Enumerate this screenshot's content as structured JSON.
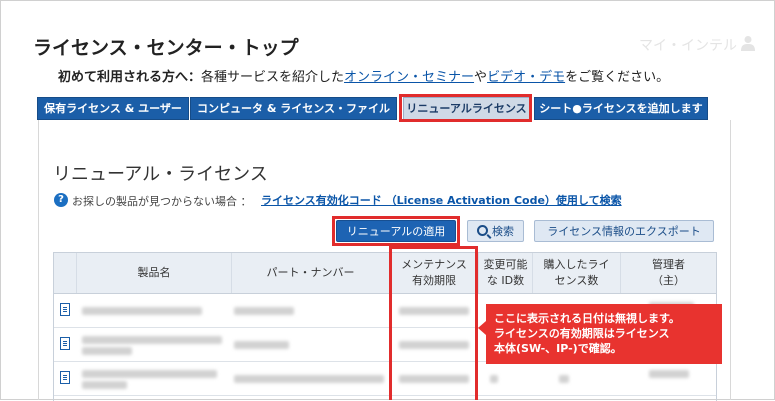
{
  "header": {
    "title": "ライセンス・センター・トップ",
    "account_label": "マイ・インテル"
  },
  "intro": {
    "lead": "初めて利用される方へ：",
    "text1": "各種サービスを紹介した",
    "link1": "オンライン・セミナー",
    "text2": "や",
    "link2": "ビデオ・デモ",
    "text3": "をご覧ください。"
  },
  "tabs": [
    {
      "label": "保有ライセンス & ユーザー"
    },
    {
      "label": "コンピュータ & ライセンス・ファイル"
    },
    {
      "label": "リニューアルライセンス"
    },
    {
      "label": "シート●ライセンスを追加します"
    }
  ],
  "main": {
    "section_title": "リニューアル・ライセンス",
    "help_text": "お探しの製品が見つからない場合 ：",
    "help_link": "ライセンス有効化コード （License Activation Code）使用して検索",
    "buttons": {
      "apply": "リニューアルの適用",
      "search": "検索",
      "export": "ライセンス情報のエクスポート"
    },
    "table": {
      "headers": {
        "product": "製品名",
        "part_number": "パート・ナンバー",
        "maintenance_1": "メンテナンス",
        "maintenance_2": "有効期限",
        "changeable_1": "変更可能",
        "changeable_2": "な ID数",
        "purchased_1": "購入したライ",
        "purchased_2": "センス数",
        "admin_1": "管理者",
        "admin_2": "（主）"
      }
    }
  },
  "callout": {
    "line1": "ここに表示される日付は無視します。",
    "line2": "ライセンスの有効期限はライセンス",
    "line3": "本体(SW-、IP-)で確認。"
  },
  "colors": {
    "tab_blue": "#1b5ea8",
    "highlight_red": "#e12c2c",
    "link_blue": "#0a55a8"
  }
}
